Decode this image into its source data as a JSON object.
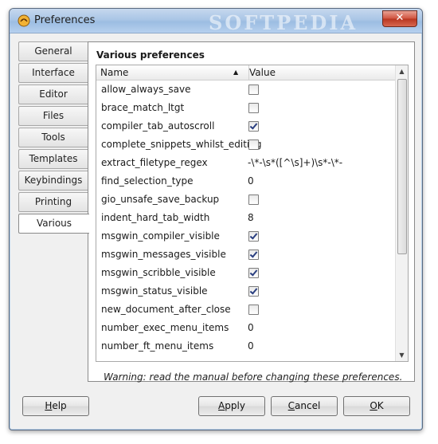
{
  "window": {
    "title": "Preferences",
    "watermark": "SOFTPEDIA",
    "close_glyph": "✕"
  },
  "tabs": [
    {
      "label": "General"
    },
    {
      "label": "Interface"
    },
    {
      "label": "Editor"
    },
    {
      "label": "Files"
    },
    {
      "label": "Tools"
    },
    {
      "label": "Templates"
    },
    {
      "label": "Keybindings"
    },
    {
      "label": "Printing"
    },
    {
      "label": "Various"
    }
  ],
  "panel": {
    "heading": "Various preferences",
    "columns": {
      "name": "Name",
      "value": "Value",
      "sort_arrow": "▲"
    },
    "rows": [
      {
        "name": "allow_always_save",
        "type": "checkbox",
        "checked": false
      },
      {
        "name": "brace_match_ltgt",
        "type": "checkbox",
        "checked": false
      },
      {
        "name": "compiler_tab_autoscroll",
        "type": "checkbox",
        "checked": true
      },
      {
        "name": "complete_snippets_whilst_editing",
        "type": "checkbox",
        "checked": false
      },
      {
        "name": "extract_filetype_regex",
        "type": "text",
        "value": "-\\*-\\s*([^\\s]+)\\s*-\\*-"
      },
      {
        "name": "find_selection_type",
        "type": "text",
        "value": "0"
      },
      {
        "name": "gio_unsafe_save_backup",
        "type": "checkbox",
        "checked": false
      },
      {
        "name": "indent_hard_tab_width",
        "type": "text",
        "value": "8"
      },
      {
        "name": "msgwin_compiler_visible",
        "type": "checkbox",
        "checked": true
      },
      {
        "name": "msgwin_messages_visible",
        "type": "checkbox",
        "checked": true
      },
      {
        "name": "msgwin_scribble_visible",
        "type": "checkbox",
        "checked": true
      },
      {
        "name": "msgwin_status_visible",
        "type": "checkbox",
        "checked": true
      },
      {
        "name": "new_document_after_close",
        "type": "checkbox",
        "checked": false
      },
      {
        "name": "number_exec_menu_items",
        "type": "text",
        "value": "0"
      },
      {
        "name": "number_ft_menu_items",
        "type": "text",
        "value": "0"
      }
    ],
    "warning": "Warning: read the manual before changing these preferences."
  },
  "buttons": {
    "help": {
      "label": "Help",
      "mnemonic": "H"
    },
    "apply": {
      "label": "Apply",
      "mnemonic": "A"
    },
    "cancel": {
      "label": "Cancel",
      "mnemonic": "C"
    },
    "ok": {
      "label": "OK",
      "mnemonic": "O"
    }
  },
  "colors": {
    "titlebar": "#aac6e6",
    "close_button": "#d0533e",
    "check_mark": "#2a3f80"
  }
}
